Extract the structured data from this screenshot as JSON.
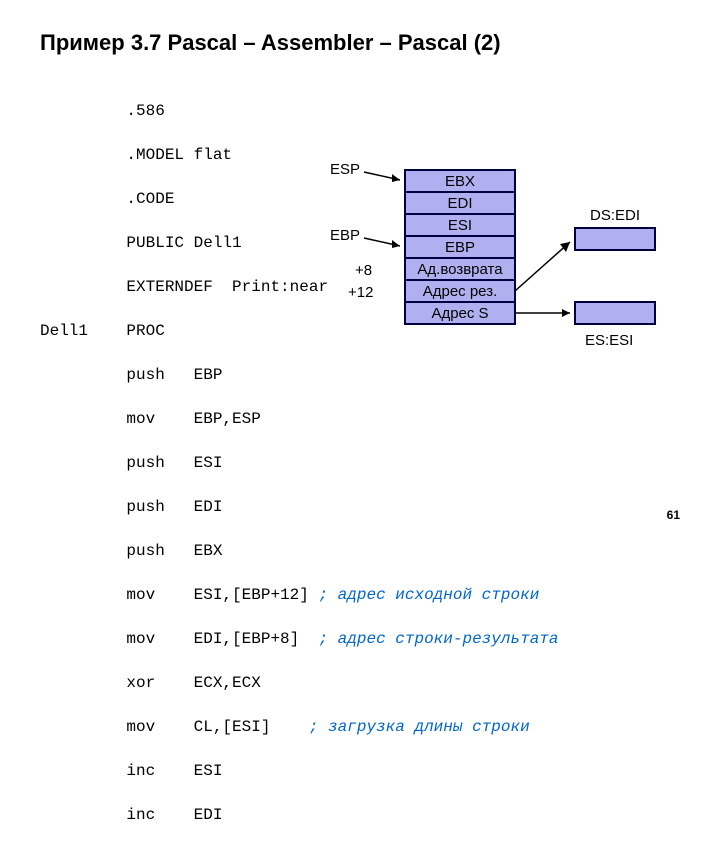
{
  "title": "Пример 3.7 Pascal – Assembler – Pascal (2)",
  "slide_number": "61",
  "code": {
    "l0": "         .586",
    "l1": "         .MODEL flat",
    "l2": "         .CODE",
    "l3": "         PUBLIC Dell1",
    "l4": "         EXTERNDEF  Print:near",
    "l5": "Dell1    PROC",
    "l6": "         push   EBP",
    "l7": "         mov    EBP,ESP",
    "l8": "         push   ESI",
    "l9": "         push   EDI",
    "l10": "         push   EBX",
    "l11a": "         mov    ESI,[EBP+12] ",
    "l11c": "; адрес исходной строки",
    "l12a": "         mov    EDI,[EBP+8]  ",
    "l12c": "; адрес строки-результата",
    "l13": "         xor    ECX,ECX",
    "l14a": "         mov    CL,[ESI]    ",
    "l14c": "; загрузка длины строки",
    "l15": "         inc    ESI",
    "l16": "         inc    EDI"
  },
  "stack": {
    "cells": [
      "EBX",
      "EDI",
      "ESI",
      "EBP",
      "Ад.возврата",
      "Адрес рез.",
      "Адрес S"
    ],
    "left_labels": {
      "esp": "ESP",
      "ebp": "EBP",
      "p8": "+8",
      "p12": "+12"
    },
    "right_labels": {
      "dsedi": "DS:EDI",
      "esesi": "ES:ESI"
    }
  }
}
